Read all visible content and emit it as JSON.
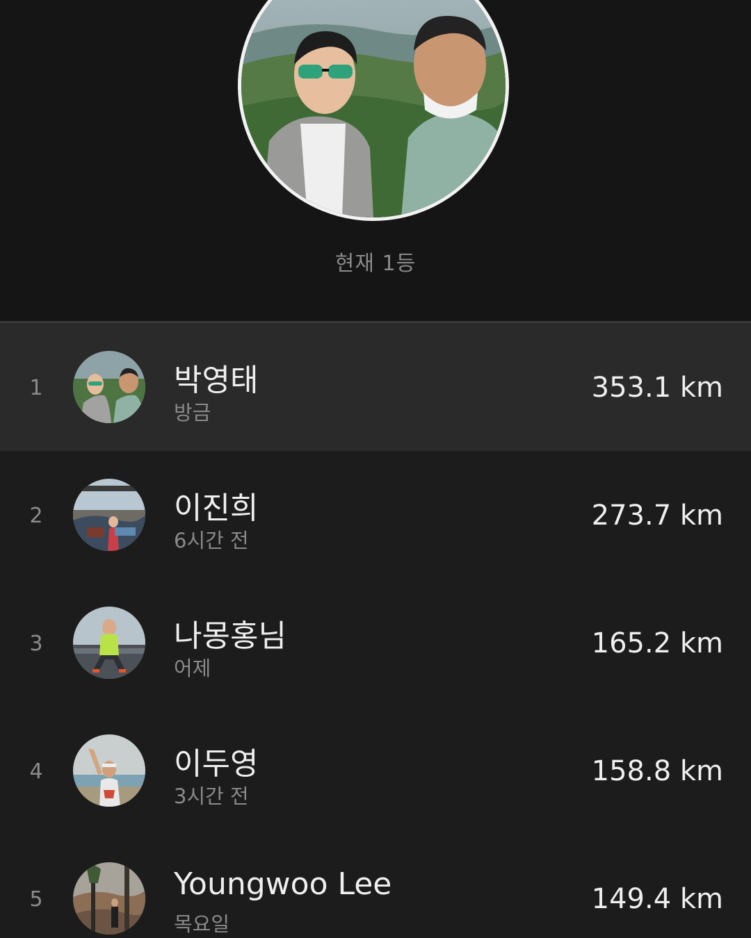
{
  "header": {
    "rank_caption": "현재 1등"
  },
  "leaderboard": [
    {
      "rank": "1",
      "name": "박영태",
      "time": "방금",
      "distance": "353.1 km",
      "highlighted": true
    },
    {
      "rank": "2",
      "name": "이진희",
      "time": "6시간 전",
      "distance": "273.7 km",
      "highlighted": false
    },
    {
      "rank": "3",
      "name": "나몽홍님",
      "time": "어제",
      "distance": "165.2 km",
      "highlighted": false
    },
    {
      "rank": "4",
      "name": "이두영",
      "time": "3시간 전",
      "distance": "158.8 km",
      "highlighted": false
    },
    {
      "rank": "5",
      "name": "Youngwoo Lee",
      "time": "목요일",
      "distance": "149.4 km",
      "highlighted": false
    }
  ],
  "colors": {
    "background": "#151515",
    "row": "#1c1c1c",
    "row_highlight": "#2a2a2a",
    "text_primary": "#efefef",
    "text_secondary": "#8a8a8a"
  }
}
